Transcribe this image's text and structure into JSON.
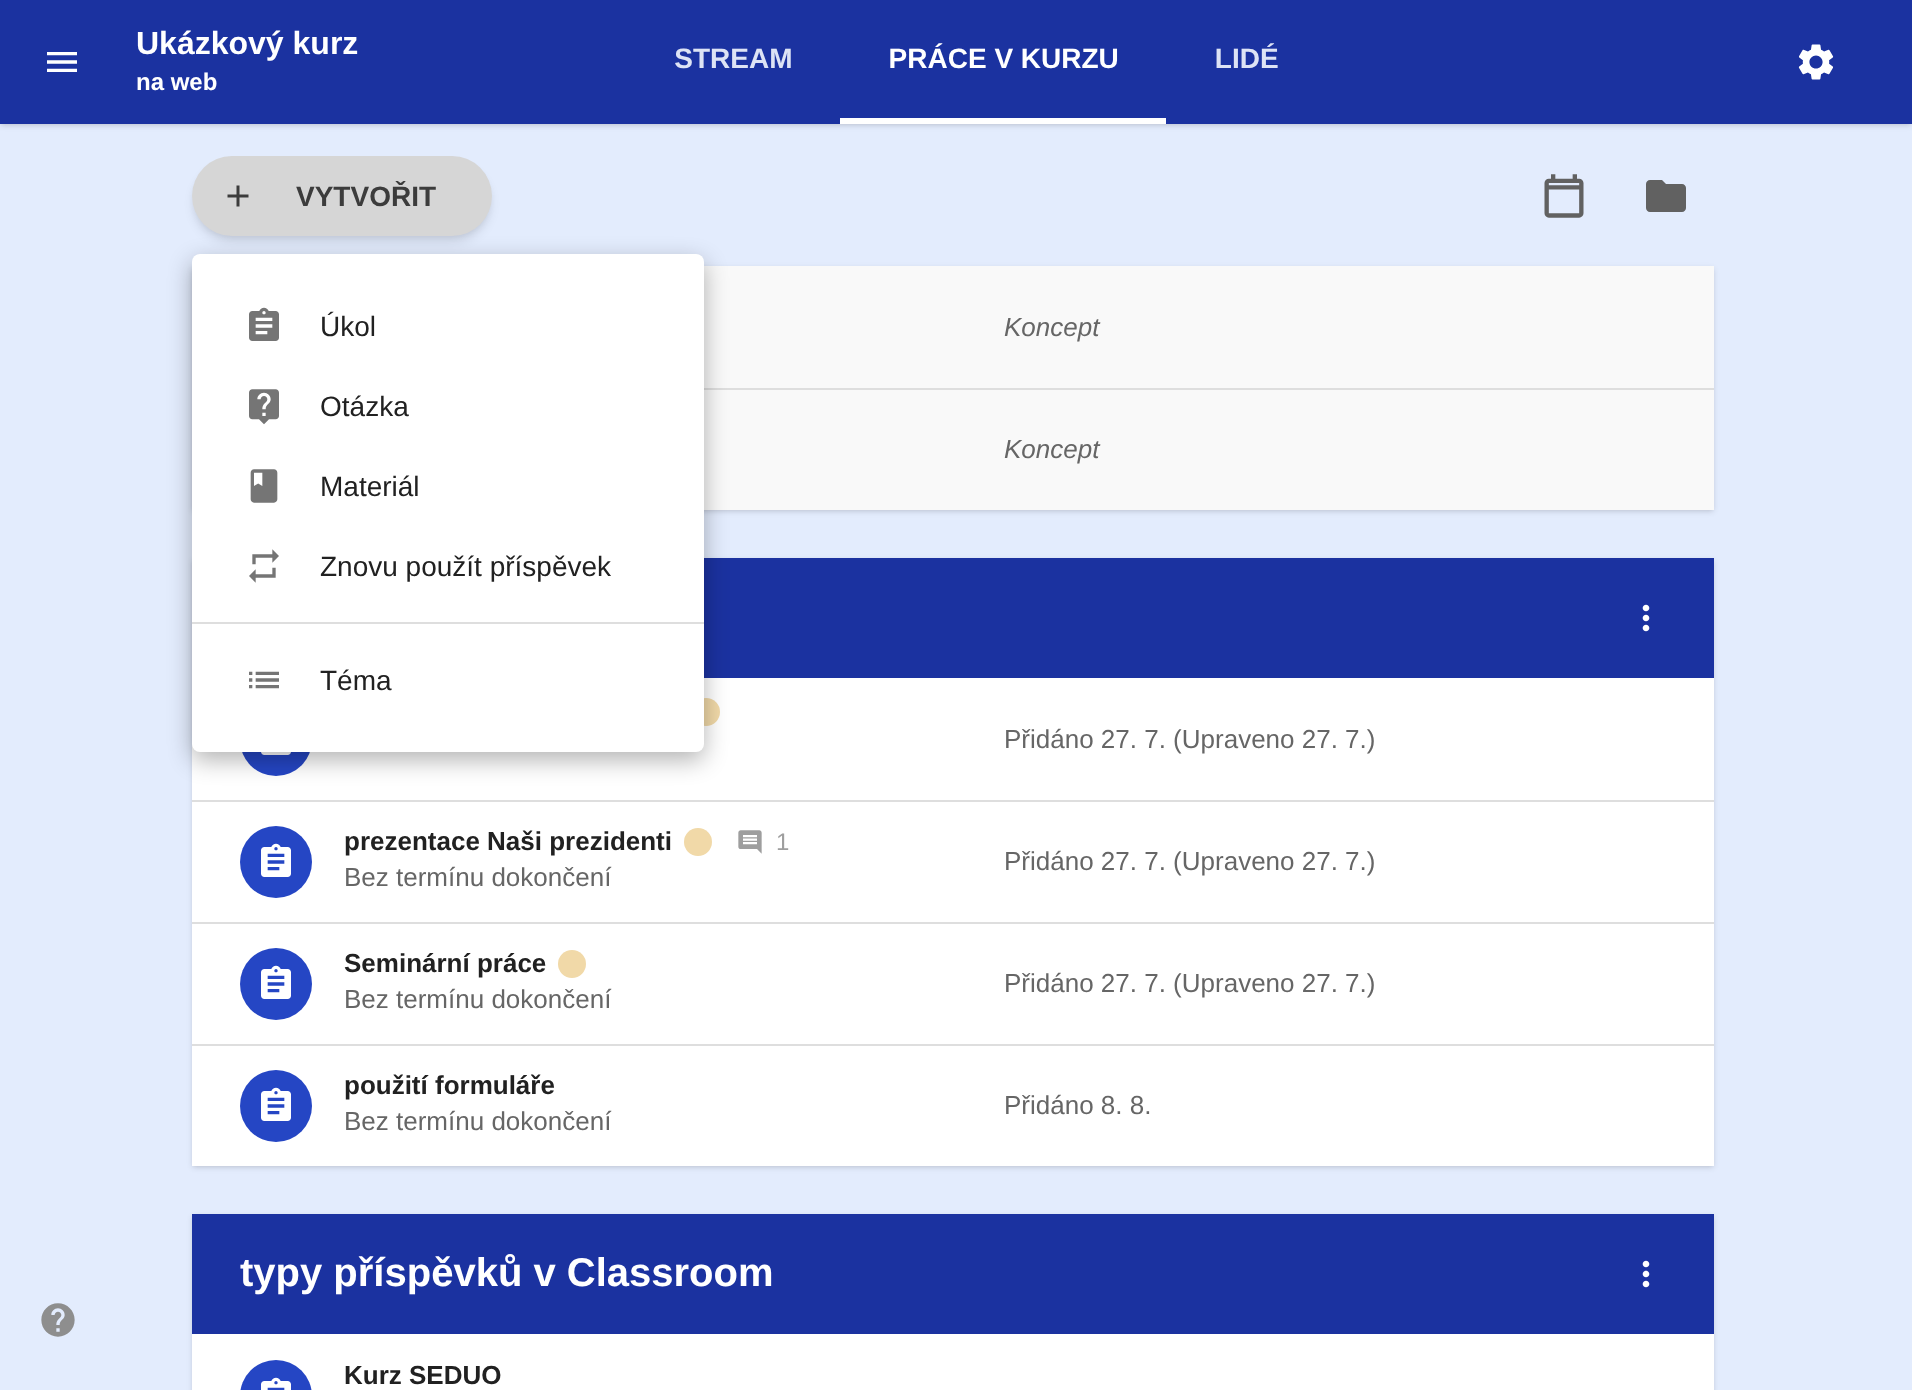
{
  "header": {
    "course_title": "Ukázkový kurz",
    "course_subtitle": "na web",
    "tabs": [
      {
        "label": "STREAM",
        "selected": false
      },
      {
        "label": "PRÁCE V KURZU",
        "selected": true
      },
      {
        "label": "LIDÉ",
        "selected": false
      }
    ]
  },
  "create_button": {
    "label": "VYTVOŘIT"
  },
  "drafts": [
    {
      "status": "Koncept"
    },
    {
      "status": "Koncept"
    }
  ],
  "topics": [
    {
      "rows": [
        {
          "emoji": true,
          "date": "Přidáno 27. 7. (Upraveno 27. 7.)"
        },
        {
          "title": "prezentace Naši prezidenti",
          "emoji": true,
          "comments": "1",
          "subtitle": "Bez termínu dokončení",
          "date": "Přidáno 27. 7. (Upraveno 27. 7.)"
        },
        {
          "title": "Seminární práce",
          "emoji": true,
          "subtitle": "Bez termínu dokončení",
          "date": "Přidáno 27. 7. (Upraveno 27. 7.)"
        },
        {
          "title": "použití formuláře",
          "emoji": false,
          "subtitle": "Bez termínu dokončení",
          "date": "Přidáno 8. 8."
        }
      ]
    },
    {
      "title": "typy příspěvků v Classroom",
      "rows": [
        {
          "title": "Kurz SEDUO",
          "emoji": false
        }
      ]
    }
  ],
  "create_menu": {
    "items": [
      {
        "kind": "assignment",
        "label": "Úkol"
      },
      {
        "kind": "question",
        "label": "Otázka"
      },
      {
        "kind": "material",
        "label": "Materiál"
      },
      {
        "kind": "reuse",
        "label": "Znovu použít příspěvek"
      },
      {
        "kind": "topic",
        "label": "Téma"
      }
    ]
  }
}
